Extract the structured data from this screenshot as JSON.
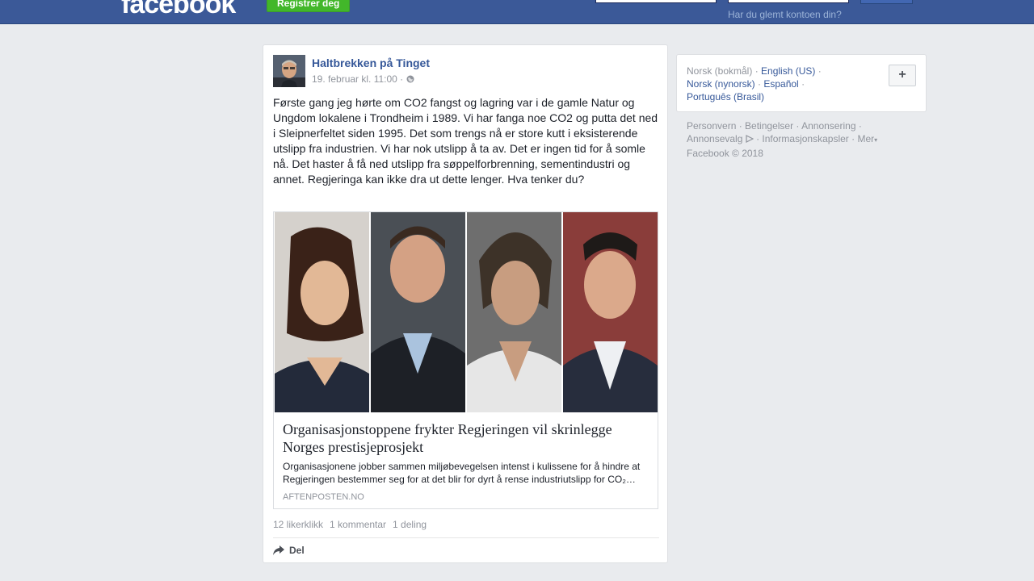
{
  "header": {
    "logo": "facebook",
    "register_label": "Registrer deg",
    "forgot_label": "Har du glemt kontoen din?"
  },
  "post": {
    "author": "Haltbrekken på Tinget",
    "date": "19. februar kl. 11:00 ·",
    "text": "Første gang jeg hørte om CO2 fangst og lagring var i de gamle Natur og Ungdom lokalene i Trondheim i 1989. Vi har fanga noe CO2 og putta det ned i Sleipnerfeltet siden 1995. Det som trengs nå er store kutt i eksisterende utslipp fra industrien. Vi har nok utslipp å ta av. Det er ingen tid for å somle nå. Det haster å få ned utslipp fra søppelforbrenning, sementindustri og annet. Regjeringa kan ikke dra ut dette lenger. Hva tenker du?",
    "link": {
      "title": "Organisasjonstoppene frykter Regjeringen vil skrinlegge Norges prestisjeprosjekt",
      "description": "Organisasjonene jobber sammen miljøbevegelsen intenst i kulissene for å hindre at Regjeringen bestemmer seg for at det blir for dyrt å rense industriutslipp for CO₂…",
      "domain": "AFTENPOSTEN.NO"
    },
    "stats": {
      "likes": "12 likerklikk",
      "comments": "1 kommentar",
      "shares": "1 deling"
    },
    "share_label": "Del"
  },
  "languages": {
    "current": "Norsk (bokmål)",
    "items": [
      "English (US)",
      "Norsk (nynorsk)",
      "Español",
      "Português (Brasil)"
    ],
    "add_label": "+"
  },
  "footer": {
    "links": [
      "Personvern",
      "Betingelser",
      "Annonsering",
      "Annonsevalg",
      "Informasjonskapsler",
      "Mer"
    ],
    "copyright": "Facebook © 2018"
  },
  "colors": {
    "brand_blue": "#3b5998",
    "link_blue": "#365899",
    "register_green": "#42b72a"
  }
}
